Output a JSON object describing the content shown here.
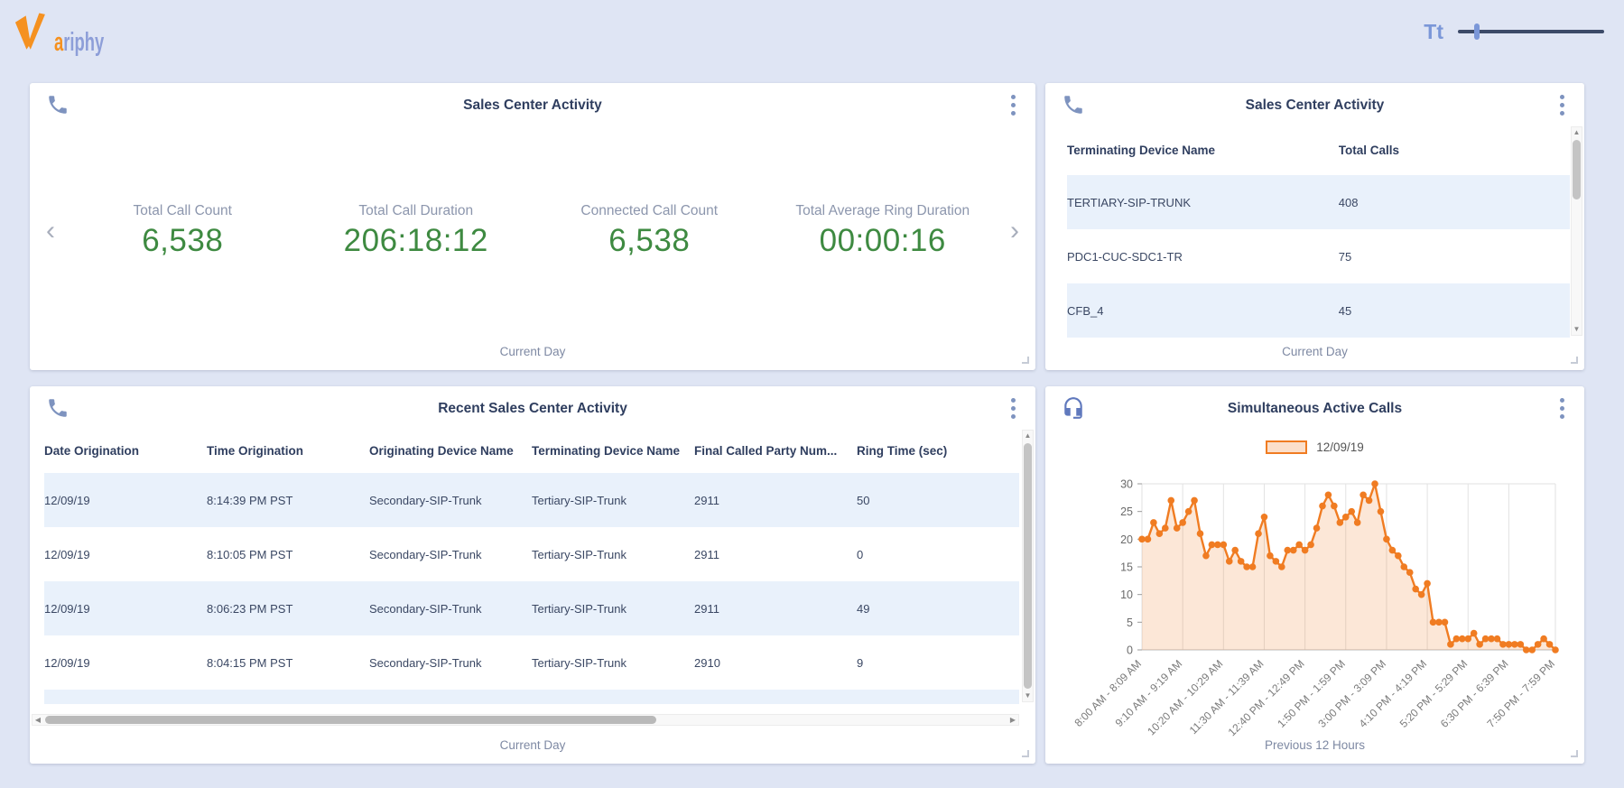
{
  "topbar": {
    "logo_first_letter": "a",
    "logo_rest": "riphy",
    "text_size_label": "Tt"
  },
  "colors": {
    "page_bg": "#dfe5f4",
    "accent_orange": "#f07c22",
    "value_green": "#3e8a41",
    "icon_blue": "#7e93bf",
    "stripe_blue": "#e9f1fb"
  },
  "cards": {
    "kpi": {
      "title": "Sales Center Activity",
      "footer": "Current Day",
      "kpis": [
        {
          "label": "Total Call Count",
          "value": "6,538"
        },
        {
          "label": "Total Call Duration",
          "value": "206:18:12"
        },
        {
          "label": "Connected Call Count",
          "value": "6,538"
        },
        {
          "label": "Total Average Ring Duration",
          "value": "00:00:16"
        }
      ]
    },
    "device_table": {
      "title": "Sales Center Activity",
      "footer": "Current Day",
      "columns": [
        "Terminating Device Name",
        "Total Calls"
      ],
      "rows": [
        [
          "TERTIARY-SIP-TRUNK",
          "408"
        ],
        [
          "PDC1-CUC-SDC1-TR",
          "75"
        ],
        [
          "CFB_4",
          "45"
        ]
      ]
    },
    "recent_table": {
      "title": "Recent Sales Center Activity",
      "footer": "Current Day",
      "columns": [
        "Date Origination",
        "Time Origination",
        "Originating Device Name",
        "Terminating Device Name",
        "Final Called Party Num...",
        "Ring Time (sec)"
      ],
      "rows": [
        [
          "12/09/19",
          "8:14:39 PM PST",
          "Secondary-SIP-Trunk",
          "Tertiary-SIP-Trunk",
          "2911",
          "50"
        ],
        [
          "12/09/19",
          "8:10:05 PM PST",
          "Secondary-SIP-Trunk",
          "Tertiary-SIP-Trunk",
          "2911",
          "0"
        ],
        [
          "12/09/19",
          "8:06:23 PM PST",
          "Secondary-SIP-Trunk",
          "Tertiary-SIP-Trunk",
          "2911",
          "49"
        ],
        [
          "12/09/19",
          "8:04:15 PM PST",
          "Secondary-SIP-Trunk",
          "Tertiary-SIP-Trunk",
          "2910",
          "9"
        ]
      ]
    },
    "chart_card": {
      "title": "Simultaneous Active Calls",
      "footer": "Previous 12 Hours"
    }
  },
  "chart_data": {
    "type": "line",
    "title": "Simultaneous Active Calls",
    "legend_position": "top",
    "area_fill": true,
    "grid": "vertical-ticks",
    "ylim": [
      0,
      30
    ],
    "yticks": [
      0,
      5,
      10,
      15,
      20,
      25,
      30
    ],
    "x_tick_indices": [
      0,
      7,
      14,
      21,
      28,
      35,
      42,
      49,
      56,
      63,
      71
    ],
    "x_tick_labels": [
      "8:00 AM - 8:09 AM",
      "9:10 AM - 9:19 AM",
      "10:20 AM - 10:29 AM",
      "11:30 AM - 11:39 AM",
      "12:40 PM - 12:49 PM",
      "1:50 PM - 1:59 PM",
      "3:00 PM - 3:09 PM",
      "4:10 PM - 4:19 PM",
      "5:20 PM - 5:29 PM",
      "6:30 PM - 6:39 PM",
      "7:50 PM - 7:59 PM"
    ],
    "series": [
      {
        "name": "12/09/19",
        "color": "#f07c22",
        "values": [
          20,
          20,
          23,
          21,
          22,
          27,
          22,
          23,
          25,
          27,
          21,
          17,
          19,
          19,
          19,
          16,
          18,
          16,
          15,
          15,
          21,
          24,
          17,
          16,
          15,
          18,
          18,
          19,
          18,
          19,
          22,
          26,
          28,
          26,
          23,
          24,
          25,
          23,
          28,
          27,
          30,
          25,
          20,
          18,
          17,
          15,
          14,
          11,
          10,
          12,
          5,
          5,
          5,
          1,
          2,
          2,
          2,
          3,
          1,
          2,
          2,
          2,
          1,
          1,
          1,
          1,
          0,
          0,
          1,
          2,
          1,
          0
        ]
      }
    ]
  }
}
